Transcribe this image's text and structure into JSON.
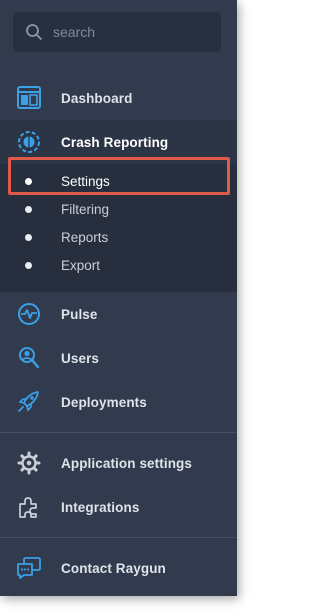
{
  "search": {
    "placeholder": "search",
    "icon": "search-icon"
  },
  "nav": {
    "dashboard": {
      "label": "Dashboard",
      "icon": "dashboard-icon"
    },
    "crash_reporting": {
      "label": "Crash Reporting",
      "icon": "crash-reporting-icon",
      "sub_items": [
        {
          "label": "Settings"
        },
        {
          "label": "Filtering"
        },
        {
          "label": "Reports"
        },
        {
          "label": "Export"
        }
      ]
    },
    "pulse": {
      "label": "Pulse",
      "icon": "pulse-icon"
    },
    "users": {
      "label": "Users",
      "icon": "users-icon"
    },
    "deployments": {
      "label": "Deployments",
      "icon": "rocket-icon"
    },
    "application_settings": {
      "label": "Application settings",
      "icon": "gear-icon"
    },
    "integrations": {
      "label": "Integrations",
      "icon": "puzzle-icon"
    },
    "contact": {
      "label": "Contact Raygun",
      "icon": "chat-icon"
    }
  },
  "colors": {
    "panel_bg": "#323b4d",
    "sub_bg": "#272f3e",
    "icon_blue": "#3aa0e8",
    "highlight": "#e05a4a"
  }
}
